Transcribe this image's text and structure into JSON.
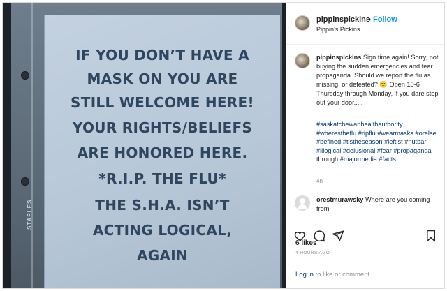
{
  "photo": {
    "sign_lines": [
      "IF YOU DON’T HAVE A",
      "MASK ON YOU ARE",
      "STILL WELCOME HERE!",
      "YOUR RIGHTS/BELIEFS",
      "ARE HONORED HERE.",
      "*R.I.P. THE FLU*",
      "THE S.H.A. ISN’T",
      "ACTING LOGICAL,",
      "AGAIN"
    ],
    "sleeve_brand": "STAPLES"
  },
  "header": {
    "username": "pippinspickins",
    "separator": "•",
    "follow_label": "Follow",
    "location": "Pippin’s Pickins"
  },
  "caption": {
    "username": "pippinspickins",
    "text_part1": "Sign time again! Sorry, not buying the sudden emergencies and fear propaganda. Should we report the flu as missing, or defeated?",
    "emoji": "🙂",
    "text_part2": "Open 10-6 Thursday through Monday, if you dare step out your door.....",
    "tags": [
      "#saskatchewanhealthauthority",
      "#wherestheflu",
      "#ripflu",
      "#wearmasks",
      "#orelse",
      "#befined",
      "#tistheseason",
      "#leftist",
      "#nutbar",
      "#illogical",
      "#delusional",
      "#fear",
      "#propaganda"
    ],
    "tags_joiner": "through",
    "tags_tail": [
      "#majormedia",
      "#facts"
    ],
    "time": "4h"
  },
  "comment": {
    "username": "orestmurawsky",
    "text": "Where are you coming from"
  },
  "actions": {
    "likes": "6 likes",
    "time_ago": "4 HOURS AGO"
  },
  "footer": {
    "login_link": "Log in",
    "login_rest": "to like or comment."
  },
  "colors": {
    "link_blue": "#0095f6",
    "hashtag": "#00376b",
    "sign_text": "#2e4660"
  }
}
